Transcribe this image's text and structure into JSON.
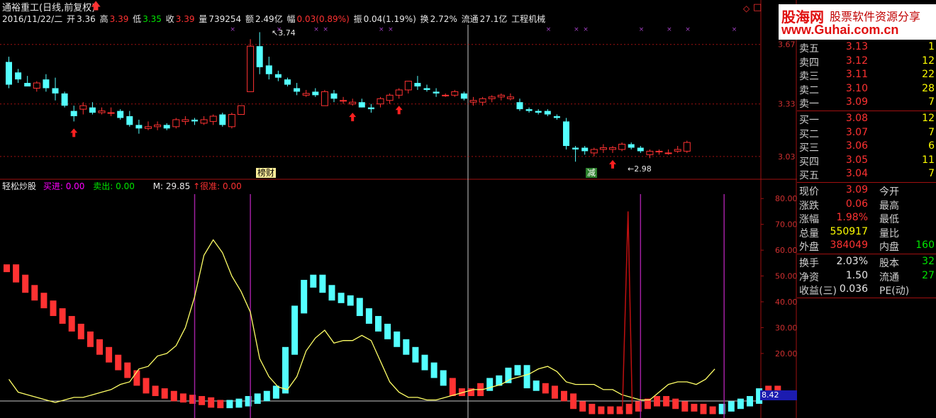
{
  "header": {
    "stock_title": "通裕重工(日线,前复权)",
    "date": "2016/11/22/二",
    "open_label": "开",
    "open": "3.36",
    "high_label": "高",
    "high": "3.39",
    "low_label": "低",
    "low": "3.35",
    "close_label": "收",
    "close": "3.39",
    "volume_label": "量",
    "volume": "739254",
    "amount_label": "额",
    "amount": "2.49亿",
    "change_label": "幅",
    "change": "0.03(0.89%)",
    "amplitude_label": "振",
    "amplitude": "0.04(1.19%)",
    "turnover_label": "换",
    "turnover": "2.72%",
    "float_label": "流通",
    "float": "27.1亿",
    "industry": "工程机械"
  },
  "indicator": {
    "name": "轻松炒股",
    "buy_label": "买进:",
    "buy": "0.00",
    "sell_label": "卖出:",
    "sell": "0.00",
    "m_label": "M:",
    "m": "29.85",
    "hi_label": "很准:",
    "hi": "0.00",
    "current_value": "8.42"
  },
  "annotations": {
    "peak_label": "3.74",
    "low_label": "2.98",
    "tag_bangcai": "榜财",
    "tag_jian": "减"
  },
  "banner": {
    "site_name": "股海网",
    "slogan": "股票软件资源分享",
    "url": "www.Guhai.com.cn"
  },
  "order_book": {
    "asks": [
      {
        "label": "卖五",
        "price": "3.13",
        "vol": "1"
      },
      {
        "label": "卖四",
        "price": "3.12",
        "vol": "12"
      },
      {
        "label": "卖三",
        "price": "3.11",
        "vol": "22"
      },
      {
        "label": "卖二",
        "price": "3.10",
        "vol": "28"
      },
      {
        "label": "卖一",
        "price": "3.09",
        "vol": "7"
      }
    ],
    "bids": [
      {
        "label": "买一",
        "price": "3.08",
        "vol": "12"
      },
      {
        "label": "买二",
        "price": "3.07",
        "vol": "7"
      },
      {
        "label": "买三",
        "price": "3.06",
        "vol": "6"
      },
      {
        "label": "买四",
        "price": "3.05",
        "vol": "11"
      },
      {
        "label": "买五",
        "price": "3.04",
        "vol": "7"
      }
    ]
  },
  "quote": {
    "rows": [
      {
        "l1": "现价",
        "v1": "3.09",
        "l2": "今开",
        "v2": "",
        "c1": "#ff3232"
      },
      {
        "l1": "涨跌",
        "v1": "0.06",
        "l2": "最高",
        "v2": "",
        "c1": "#ff3232"
      },
      {
        "l1": "涨幅",
        "v1": "1.98%",
        "l2": "最低",
        "v2": "",
        "c1": "#ff3232"
      },
      {
        "l1": "总量",
        "v1": "550917",
        "l2": "量比",
        "v2": "",
        "c1": "#ffff00"
      },
      {
        "l1": "外盘",
        "v1": "384049",
        "l2": "内盘",
        "v2": "160",
        "c1": "#ff3232"
      },
      {
        "l1": "换手",
        "v1": "2.03%",
        "l2": "股本",
        "v2": "32",
        "c1": "#e8e8e8"
      },
      {
        "l1": "净资",
        "v1": "1.50",
        "l2": "流通",
        "v2": "27",
        "c1": "#e8e8e8"
      },
      {
        "l1": "收益(三)",
        "v1": "0.036",
        "l2": "PE(动)",
        "v2": "",
        "c1": "#e8e8e8"
      }
    ]
  },
  "axes": {
    "price_ticks": [
      "3.67",
      "3.33",
      "3.03"
    ],
    "indicator_ticks": [
      "80.00",
      "70.00",
      "60.00",
      "50.00",
      "40.00",
      "30.00",
      "20.00"
    ]
  },
  "colors": {
    "up": "#ff3232",
    "down": "#54ffff",
    "grid": "#a01010",
    "m_line": "#ffff66",
    "buy_line": "#a020a0",
    "spike": "#c01010"
  },
  "chart_data": [
    {
      "type": "candlestick",
      "title": "通裕重工(日线,前复权)",
      "ylim": [
        2.92,
        3.77
      ],
      "ohlc": [
        [
          3.57,
          3.6,
          3.42,
          3.44
        ],
        [
          3.51,
          3.53,
          3.45,
          3.47
        ],
        [
          3.45,
          3.49,
          3.44,
          3.43
        ],
        [
          3.42,
          3.46,
          3.4,
          3.45
        ],
        [
          3.47,
          3.5,
          3.4,
          3.42
        ],
        [
          3.42,
          3.48,
          3.35,
          3.39
        ],
        [
          3.39,
          3.4,
          3.31,
          3.32
        ],
        [
          3.29,
          3.32,
          3.23,
          3.26
        ],
        [
          3.3,
          3.34,
          3.27,
          3.32
        ],
        [
          3.31,
          3.34,
          3.27,
          3.28
        ],
        [
          3.28,
          3.31,
          3.27,
          3.29
        ],
        [
          3.28,
          3.31,
          3.26,
          3.28
        ],
        [
          3.29,
          3.3,
          3.24,
          3.25
        ],
        [
          3.26,
          3.29,
          3.2,
          3.21
        ],
        [
          3.21,
          3.24,
          3.16,
          3.19
        ],
        [
          3.19,
          3.23,
          3.18,
          3.2
        ],
        [
          3.2,
          3.23,
          3.18,
          3.21
        ],
        [
          3.21,
          3.22,
          3.18,
          3.19
        ],
        [
          3.2,
          3.25,
          3.19,
          3.24
        ],
        [
          3.23,
          3.26,
          3.21,
          3.24
        ],
        [
          3.24,
          3.25,
          3.21,
          3.23
        ],
        [
          3.22,
          3.26,
          3.21,
          3.24
        ],
        [
          3.23,
          3.27,
          3.21,
          3.26
        ],
        [
          3.27,
          3.28,
          3.2,
          3.21
        ],
        [
          3.2,
          3.28,
          3.19,
          3.27
        ],
        [
          3.27,
          3.32,
          3.27,
          3.32
        ],
        [
          3.4,
          3.7,
          3.4,
          3.66
        ],
        [
          3.66,
          3.74,
          3.5,
          3.54
        ],
        [
          3.55,
          3.6,
          3.47,
          3.5
        ],
        [
          3.5,
          3.52,
          3.46,
          3.48
        ],
        [
          3.47,
          3.48,
          3.43,
          3.44
        ],
        [
          3.42,
          3.45,
          3.38,
          3.4
        ],
        [
          3.38,
          3.41,
          3.37,
          3.39
        ],
        [
          3.4,
          3.42,
          3.37,
          3.38
        ],
        [
          3.32,
          3.41,
          3.32,
          3.4
        ],
        [
          3.39,
          3.41,
          3.34,
          3.36
        ],
        [
          3.35,
          3.37,
          3.33,
          3.35
        ],
        [
          3.33,
          3.36,
          3.32,
          3.34
        ],
        [
          3.34,
          3.36,
          3.31,
          3.31
        ],
        [
          3.31,
          3.33,
          3.28,
          3.3
        ],
        [
          3.33,
          3.37,
          3.31,
          3.36
        ],
        [
          3.35,
          3.39,
          3.33,
          3.38
        ],
        [
          3.38,
          3.42,
          3.36,
          3.41
        ],
        [
          3.41,
          3.46,
          3.39,
          3.46
        ],
        [
          3.45,
          3.49,
          3.41,
          3.43
        ],
        [
          3.42,
          3.44,
          3.4,
          3.41
        ],
        [
          3.4,
          3.42,
          3.37,
          3.39
        ],
        [
          3.38,
          3.39,
          3.37,
          3.38
        ],
        [
          3.38,
          3.41,
          3.37,
          3.4
        ],
        [
          3.39,
          3.4,
          3.35,
          3.36
        ],
        [
          3.34,
          3.37,
          3.32,
          3.35
        ],
        [
          3.34,
          3.37,
          3.32,
          3.36
        ],
        [
          3.36,
          3.38,
          3.34,
          3.37
        ],
        [
          3.37,
          3.39,
          3.35,
          3.38
        ],
        [
          3.36,
          3.39,
          3.35,
          3.37
        ],
        [
          3.34,
          3.36,
          3.29,
          3.3
        ],
        [
          3.3,
          3.31,
          3.28,
          3.29
        ],
        [
          3.29,
          3.3,
          3.27,
          3.28
        ],
        [
          3.29,
          3.3,
          3.26,
          3.27
        ],
        [
          3.26,
          3.27,
          3.24,
          3.25
        ],
        [
          3.23,
          3.25,
          3.07,
          3.09
        ],
        [
          3.08,
          3.09,
          3.0,
          3.07
        ],
        [
          3.08,
          3.09,
          3.04,
          3.06
        ],
        [
          3.05,
          3.08,
          3.03,
          3.07
        ],
        [
          3.07,
          3.1,
          3.05,
          3.08
        ],
        [
          3.07,
          3.09,
          3.05,
          3.08
        ],
        [
          3.07,
          3.11,
          3.06,
          3.1
        ],
        [
          3.1,
          3.11,
          3.07,
          3.08
        ],
        [
          3.08,
          3.09,
          3.05,
          3.06
        ],
        [
          3.04,
          3.07,
          3.02,
          3.06
        ],
        [
          3.06,
          3.07,
          3.04,
          3.06
        ],
        [
          3.05,
          3.07,
          3.04,
          3.05
        ],
        [
          3.06,
          3.09,
          3.05,
          3.07
        ],
        [
          3.06,
          3.12,
          3.05,
          3.11
        ]
      ]
    },
    {
      "type": "bar",
      "title": "轻松炒股",
      "ylim": [
        -5,
        85
      ],
      "values": [
        53,
        49,
        45,
        42,
        39,
        36,
        33,
        30,
        27,
        24,
        21,
        18,
        15,
        12,
        9,
        6,
        5,
        4,
        3,
        2.5,
        2,
        1.5,
        0.5,
        0.3,
        0.5,
        1,
        2,
        3,
        4,
        6,
        21,
        37,
        47,
        49,
        45,
        42,
        41,
        40,
        36,
        33,
        30,
        27,
        24,
        21,
        18,
        15,
        12,
        9,
        5,
        5,
        5,
        7,
        9,
        10,
        13,
        14,
        8,
        7,
        6,
        4,
        3,
        0,
        -1,
        -2,
        -2,
        -2,
        -2,
        -1,
        0,
        1,
        2,
        1,
        0,
        -1,
        -1,
        -2,
        -2,
        -1,
        0,
        1,
        2,
        5,
        6,
        6
      ],
      "bar_types": [
        "u",
        "u",
        "u",
        "u",
        "u",
        "u",
        "u",
        "u",
        "u",
        "u",
        "u",
        "u",
        "u",
        "u",
        "u",
        "u",
        "u",
        "u",
        "u",
        "u",
        "u",
        "u",
        "u",
        "u",
        "d",
        "d",
        "d",
        "d",
        "d",
        "d",
        "d",
        "d",
        "d",
        "d",
        "d",
        "d",
        "d",
        "d",
        "d",
        "d",
        "d",
        "d",
        "d",
        "d",
        "d",
        "d",
        "d",
        "d",
        "u",
        "u",
        "u",
        "u",
        "d",
        "d",
        "d",
        "d",
        "d",
        "d",
        "u",
        "u",
        "u",
        "u",
        "u",
        "u",
        "u",
        "u",
        "u",
        "u",
        "u",
        "u",
        "u",
        "u",
        "u",
        "u",
        "u",
        "u",
        "u",
        "d",
        "d",
        "d",
        "d",
        "d",
        "u",
        "u",
        "d",
        "d"
      ],
      "m_line": [
        10,
        5,
        4,
        3,
        2,
        1,
        2,
        3,
        3,
        4,
        5,
        6,
        8,
        9,
        14,
        15,
        19,
        20,
        23,
        30,
        42,
        58,
        64,
        59,
        50,
        44,
        36,
        18,
        11,
        7,
        6,
        11,
        21,
        26,
        29,
        24,
        25,
        25,
        27,
        25,
        17,
        9,
        5,
        3,
        3,
        2,
        2,
        3,
        4,
        5,
        6,
        6,
        7,
        8,
        10,
        11,
        12,
        14,
        15,
        13,
        9,
        8,
        8,
        8,
        6,
        6,
        4,
        3,
        2,
        2,
        5,
        8,
        9,
        9,
        8,
        10,
        14
      ]
    }
  ]
}
